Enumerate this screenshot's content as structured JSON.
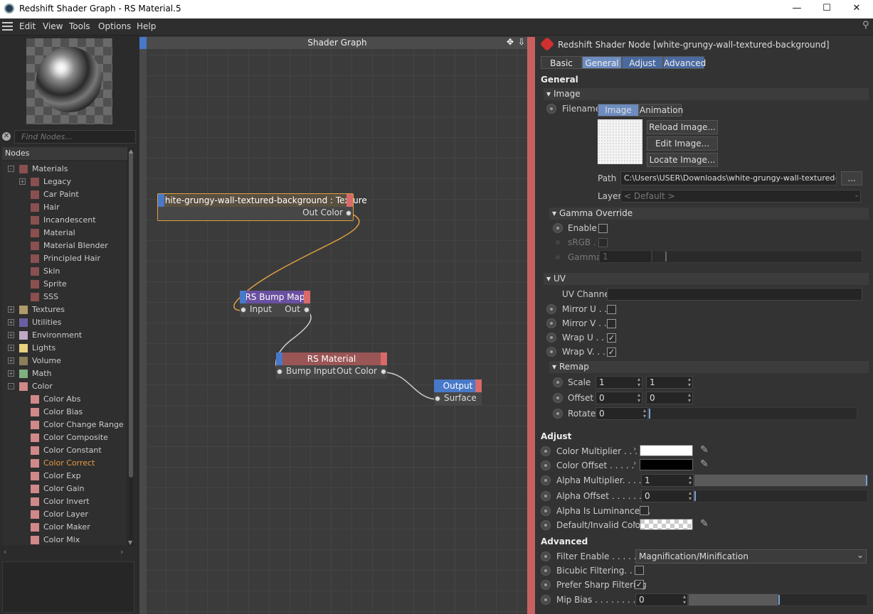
{
  "window": {
    "title": "Redshift Shader Graph - RS Material.5",
    "minimize": "—",
    "maximize": "☐",
    "close": "✕"
  },
  "menu": [
    "Edit",
    "View",
    "Tools",
    "Options",
    "Help"
  ],
  "left": {
    "search_placeholder": "Find Nodes...",
    "nodes_header": "Nodes",
    "tree": [
      {
        "label": "Materials",
        "color": "#8a4f4f",
        "level": 0,
        "exp": "-"
      },
      {
        "label": "Legacy",
        "color": "#8a4f4f",
        "level": 1,
        "exp": "+"
      },
      {
        "label": "Car Paint",
        "color": "#8a4f4f",
        "level": 1
      },
      {
        "label": "Hair",
        "color": "#8a4f4f",
        "level": 1
      },
      {
        "label": "Incandescent",
        "color": "#8a4f4f",
        "level": 1
      },
      {
        "label": "Material",
        "color": "#8a4f4f",
        "level": 1
      },
      {
        "label": "Material Blender",
        "color": "#8a4f4f",
        "level": 1
      },
      {
        "label": "Principled Hair",
        "color": "#8a4f4f",
        "level": 1
      },
      {
        "label": "Skin",
        "color": "#8a4f4f",
        "level": 1
      },
      {
        "label": "Sprite",
        "color": "#8a4f4f",
        "level": 1
      },
      {
        "label": "SSS",
        "color": "#8a4f4f",
        "level": 1
      },
      {
        "label": "Textures",
        "color": "#b09a6a",
        "level": 0,
        "exp": "+"
      },
      {
        "label": "Utilities",
        "color": "#6a5fa0",
        "level": 0,
        "exp": "+"
      },
      {
        "label": "Environment",
        "color": "#c0a8c8",
        "level": 0,
        "exp": "+"
      },
      {
        "label": "Lights",
        "color": "#e8d080",
        "level": 0,
        "exp": "+"
      },
      {
        "label": "Volume",
        "color": "#8a7f5a",
        "level": 0,
        "exp": "+"
      },
      {
        "label": "Math",
        "color": "#7fb07f",
        "level": 0,
        "exp": "+"
      },
      {
        "label": "Color",
        "color": "#d08888",
        "level": 0,
        "exp": "-"
      },
      {
        "label": "Color Abs",
        "color": "#d08888",
        "level": 1
      },
      {
        "label": "Color Bias",
        "color": "#d08888",
        "level": 1
      },
      {
        "label": "Color Change Range",
        "color": "#d08888",
        "level": 1
      },
      {
        "label": "Color Composite",
        "color": "#d08888",
        "level": 1
      },
      {
        "label": "Color Constant",
        "color": "#d08888",
        "level": 1
      },
      {
        "label": "Color Correct",
        "color": "#d08888",
        "level": 1,
        "highlight": true
      },
      {
        "label": "Color Exp",
        "color": "#d08888",
        "level": 1
      },
      {
        "label": "Color Gain",
        "color": "#d08888",
        "level": 1
      },
      {
        "label": "Color Invert",
        "color": "#d08888",
        "level": 1
      },
      {
        "label": "Color Layer",
        "color": "#d08888",
        "level": 1
      },
      {
        "label": "Color Maker",
        "color": "#d08888",
        "level": 1
      },
      {
        "label": "Color Mix",
        "color": "#d08888",
        "level": 1
      }
    ]
  },
  "graph": {
    "title": "Shader Graph",
    "texture_node": {
      "title": "white-grungy-wall-textured-background : Texture",
      "out": "Out Color"
    },
    "bump_node": {
      "title": "RS Bump Map",
      "in": "Input",
      "out": "Out"
    },
    "material_node": {
      "title": "RS Material",
      "in": "Bump Input",
      "out": "Out Color"
    },
    "output_node": {
      "title": "Output",
      "in": "Surface"
    }
  },
  "attr": {
    "title": "Redshift Shader Node [white-grungy-wall-textured-background]",
    "tabs": [
      "Basic",
      "General",
      "Adjust",
      "Advanced"
    ],
    "general": "General",
    "image_group": "Image",
    "filename": "Filename",
    "image_tab": "Image",
    "animation_tab": "Animation",
    "reload": "Reload Image...",
    "edit": "Edit Image...",
    "locate": "Locate Image...",
    "path_label": "Path",
    "path_value": "C:\\Users\\USER\\Downloads\\white-grungy-wall-textured-",
    "path_btn": "...",
    "layer_label": "Layer",
    "layer_value": "< Default >",
    "gamma_group": "Gamma Override",
    "enable": "Enable",
    "srgb": "sRGB .",
    "gamma": "Gamma",
    "gamma_value": "1",
    "uv_group": "UV",
    "uv_channel": "UV Channel",
    "mirror_u": "Mirror U . .",
    "mirror_v": "Mirror V . .",
    "wrap_u": "Wrap U . .",
    "wrap_v": "Wrap V. . .",
    "remap_group": "Remap",
    "scale": "Scale",
    "scale_x": "1",
    "scale_y": "1",
    "offset": "Offset",
    "offset_x": "0",
    "offset_y": "0",
    "rotate": "Rotate",
    "rotate_value": "0",
    "adjust": "Adjust",
    "color_mult": "Color Multiplier . . .",
    "color_offset": "Color Offset . . . . .",
    "alpha_mult": "Alpha Multiplier. . . .",
    "alpha_mult_value": "1",
    "alpha_offset": "Alpha Offset . . . . . . .",
    "alpha_offset_value": "0",
    "alpha_lum": "Alpha Is Luminance . .",
    "default_color": "Default/Invalid Color",
    "advanced": "Advanced",
    "filter_enable": "Filter Enable . . . . . .",
    "filter_value": "Magnification/Minification",
    "bicubic": "Bicubic Filtering. . . .",
    "sharp": "Prefer Sharp Filtering",
    "mip_bias": "Mip Bias . . . . . . . . .",
    "mip_value": "0",
    "check": "✓"
  }
}
